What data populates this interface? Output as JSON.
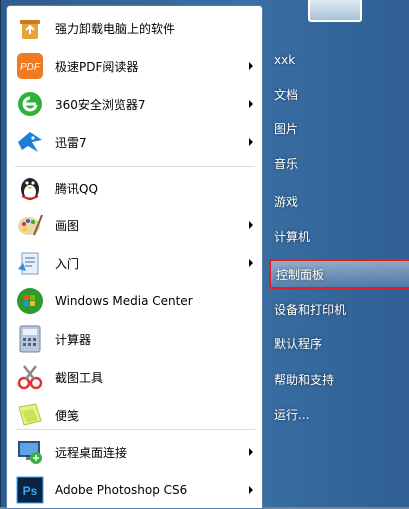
{
  "programs": [
    {
      "label": "强力卸载电脑上的软件",
      "icon": "trash-recycle-icon",
      "has_submenu": false
    },
    {
      "label": "极速PDF阅读器",
      "icon": "pdf-reader-icon",
      "has_submenu": true
    },
    {
      "label": "360安全浏览器7",
      "icon": "360-browser-icon",
      "has_submenu": true
    },
    {
      "label": "迅雷7",
      "icon": "xunlei-bird-icon",
      "has_submenu": true
    },
    {
      "label": "腾讯QQ",
      "icon": "qq-penguin-icon",
      "has_submenu": false
    },
    {
      "label": "画图",
      "icon": "paint-palette-icon",
      "has_submenu": true
    },
    {
      "label": "入门",
      "icon": "getting-started-icon",
      "has_submenu": true
    },
    {
      "label": "Windows Media Center",
      "icon": "windows-media-center-icon",
      "has_submenu": false
    },
    {
      "label": "计算器",
      "icon": "calculator-icon",
      "has_submenu": false
    },
    {
      "label": "截图工具",
      "icon": "snipping-tool-icon",
      "has_submenu": false
    },
    {
      "label": "便笺",
      "icon": "sticky-notes-icon",
      "has_submenu": false
    },
    {
      "label": "远程桌面连接",
      "icon": "remote-desktop-icon",
      "has_submenu": true
    },
    {
      "label": "Adobe Photoshop CS6",
      "icon": "photoshop-icon",
      "has_submenu": true
    }
  ],
  "right_items": [
    {
      "label": "xxk"
    },
    {
      "label": "文档"
    },
    {
      "label": "图片"
    },
    {
      "label": "音乐"
    },
    {
      "label": "游戏"
    },
    {
      "label": "计算机"
    },
    {
      "label": "控制面板",
      "selected": true
    },
    {
      "label": "设备和打印机"
    },
    {
      "label": "默认程序"
    },
    {
      "label": "帮助和支持"
    },
    {
      "label": "运行..."
    }
  ],
  "colors": {
    "highlight_border": "#e02020",
    "menu_blue": "#3a6fa3"
  }
}
